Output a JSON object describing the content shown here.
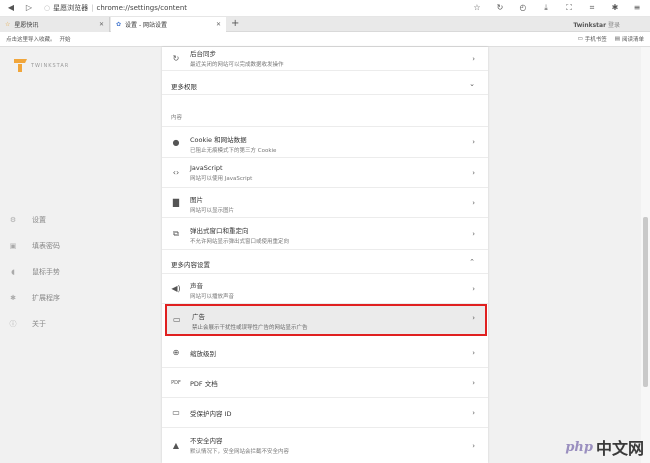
{
  "browser": {
    "address_site": "星愿浏览器",
    "address_url": "chrome://settings/content",
    "user_name": "Twinkstar",
    "user_suffix": "登录"
  },
  "tabs": [
    {
      "label": "星愿快讯"
    },
    {
      "label": "设置 - 网站设置"
    }
  ],
  "bookmarks": {
    "hint": "点击这里导入收藏。",
    "hint_action": "开始",
    "mobile_bookmarks": "手机书签",
    "reading_list": "阅读清单"
  },
  "sidebar": {
    "logo_text": "TWINKSTAR",
    "items": [
      {
        "label": "设置",
        "icon": "gear-icon"
      },
      {
        "label": "填表密码",
        "icon": "form-icon"
      },
      {
        "label": "鼠标手势",
        "icon": "mouse-icon"
      },
      {
        "label": "扩展程序",
        "icon": "puzzle-icon"
      },
      {
        "label": "关于",
        "icon": "info-icon"
      }
    ]
  },
  "content": {
    "sync_row": {
      "title": "后台同步",
      "desc": "最近关闭的网站可以完成数据收发操作"
    },
    "more_permissions": "更多权限",
    "content_label": "内容",
    "rows": [
      {
        "title": "Cookie 和网站数据",
        "desc": "已阻止无痕模式下的第三方 Cookie"
      },
      {
        "title": "JavaScript",
        "desc": "网站可以使用 JavaScript"
      },
      {
        "title": "图片",
        "desc": "网站可以显示图片"
      },
      {
        "title": "弹出式窗口和重定向",
        "desc": "不允许网站显示弹出式窗口或使用重定向"
      }
    ],
    "more_content_settings": "更多内容设置",
    "more_rows": [
      {
        "title": "声音",
        "desc": "网站可以播放声音"
      },
      {
        "title": "广告",
        "desc": "禁止会展示干扰性或误导性广告的网站显示广告"
      },
      {
        "title": "缩放级别",
        "desc": ""
      },
      {
        "title": "PDF 文档",
        "desc": ""
      },
      {
        "title": "受保护内容 ID",
        "desc": ""
      },
      {
        "title": "不安全内容",
        "desc": "默认情况下，安全网站会拦截不安全内容"
      }
    ]
  },
  "watermark": {
    "brand": "php",
    "cn": "中文网"
  }
}
